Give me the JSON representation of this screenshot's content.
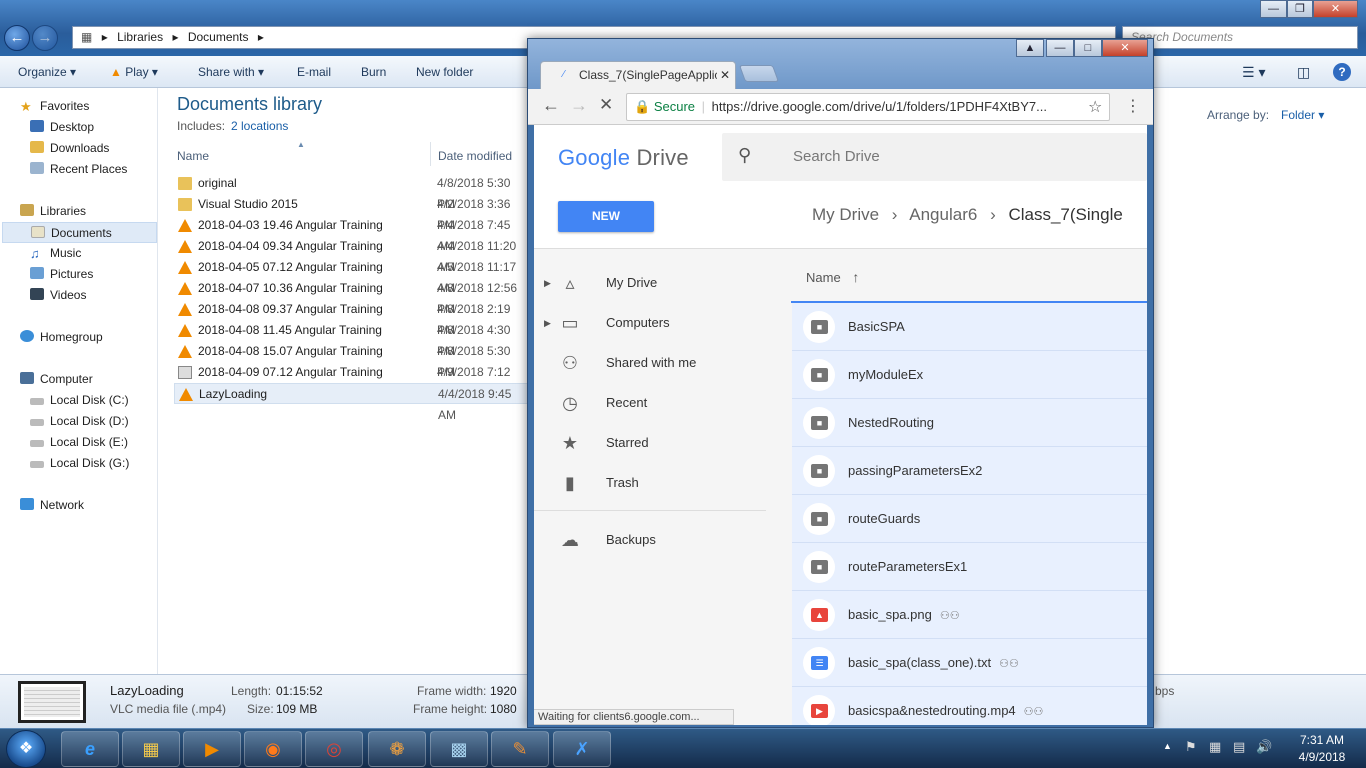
{
  "explorer": {
    "breadcrumb": [
      "Libraries",
      "Documents"
    ],
    "search_placeholder": "Search Documents",
    "toolbar": {
      "organize": "Organize",
      "play": "Play",
      "share_with": "Share with",
      "email": "E-mail",
      "burn": "Burn",
      "new_folder": "New folder"
    },
    "nav": {
      "favorites": "Favorites",
      "desktop": "Desktop",
      "downloads": "Downloads",
      "recent_places": "Recent Places",
      "libraries": "Libraries",
      "documents": "Documents",
      "music": "Music",
      "pictures": "Pictures",
      "videos": "Videos",
      "homegroup": "Homegroup",
      "computer": "Computer",
      "disk_c": "Local Disk (C:)",
      "disk_d": "Local Disk (D:)",
      "disk_e": "Local Disk (E:)",
      "disk_g": "Local Disk (G:)",
      "network": "Network"
    },
    "library_title": "Documents library",
    "includes_label": "Includes:",
    "includes_link": "2 locations",
    "arrange_by_label": "Arrange by:",
    "arrange_by_value": "Folder",
    "columns": {
      "name": "Name",
      "date_modified": "Date modified"
    },
    "files": [
      {
        "name": "original",
        "date": "4/8/2018 5:30 PM",
        "icon": "folder-icon"
      },
      {
        "name": "Visual Studio 2015",
        "date": "4/2/2018 3:36 PM",
        "icon": "folder-icon"
      },
      {
        "name": "2018-04-03 19.46 Angular Training",
        "date": "4/4/2018 7:45 AM",
        "icon": "vlc-icon"
      },
      {
        "name": "2018-04-04 09.34 Angular Training",
        "date": "4/4/2018 11:20 AM",
        "icon": "vlc-icon"
      },
      {
        "name": "2018-04-05 07.12 Angular Training",
        "date": "4/5/2018 11:17 AM",
        "icon": "vlc-icon"
      },
      {
        "name": "2018-04-07 10.36 Angular Training",
        "date": "4/8/2018 12:56 PM",
        "icon": "vlc-icon"
      },
      {
        "name": "2018-04-08 09.37 Angular Training",
        "date": "4/8/2018 2:19 PM",
        "icon": "vlc-icon"
      },
      {
        "name": "2018-04-08 11.45 Angular Training",
        "date": "4/8/2018 4:30 PM",
        "icon": "vlc-icon"
      },
      {
        "name": "2018-04-08 15.07 Angular Training",
        "date": "4/8/2018 5:30 PM",
        "icon": "vlc-icon"
      },
      {
        "name": "2018-04-09 07.12 Angular Training",
        "date": "4/9/2018 7:12 AM",
        "icon": "gear-file-icon"
      },
      {
        "name": "LazyLoading",
        "date": "4/4/2018 9:45 AM",
        "icon": "vlc-icon"
      }
    ],
    "details": {
      "name": "LazyLoading",
      "type": "VLC media file (.mp4)",
      "length_label": "Length:",
      "length": "01:15:52",
      "size_label": "Size:",
      "size": "109 MB",
      "frame_width_label": "Frame width:",
      "frame_width": "1920",
      "frame_height_label": "Frame height:",
      "frame_height": "1080",
      "bitrate_suffix": "bps"
    }
  },
  "chrome": {
    "tab_title": "Class_7(SinglePageApplic",
    "secure_label": "Secure",
    "url": "https://drive.google.com/drive/u/1/folders/1PDHF4XtBY7...",
    "status_text": "Waiting for clients6.google.com..."
  },
  "drive": {
    "logo_google": "Google",
    "logo_drive": "Drive",
    "search_placeholder": "Search Drive",
    "new_button": "NEW",
    "breadcrumb": [
      "My Drive",
      "Angular6",
      "Class_7(Single"
    ],
    "sidebar": {
      "my_drive": "My Drive",
      "computers": "Computers",
      "shared": "Shared with me",
      "recent": "Recent",
      "starred": "Starred",
      "trash": "Trash",
      "backups": "Backups"
    },
    "name_header": "Name",
    "files": [
      {
        "name": "BasicSPA",
        "type": "folder",
        "shared": false
      },
      {
        "name": "myModuleEx",
        "type": "folder",
        "shared": false
      },
      {
        "name": "NestedRouting",
        "type": "folder",
        "shared": false
      },
      {
        "name": "passingParametersEx2",
        "type": "folder",
        "shared": false
      },
      {
        "name": "routeGuards",
        "type": "folder",
        "shared": false
      },
      {
        "name": "routeParametersEx1",
        "type": "folder",
        "shared": false
      },
      {
        "name": "basic_spa.png",
        "type": "image",
        "shared": true
      },
      {
        "name": "basic_spa(class_one).txt",
        "type": "doc",
        "shared": true
      },
      {
        "name": "basicspa&nestedrouting.mp4",
        "type": "video",
        "shared": true
      }
    ]
  },
  "taskbar": {
    "time": "7:31 AM",
    "date": "4/9/2018"
  },
  "colors": {
    "drive_blue": "#4285f4",
    "selected_row": "#e8f0fe",
    "explorer_title": "#2a5d9b",
    "vlc_orange": "#f08a00"
  }
}
